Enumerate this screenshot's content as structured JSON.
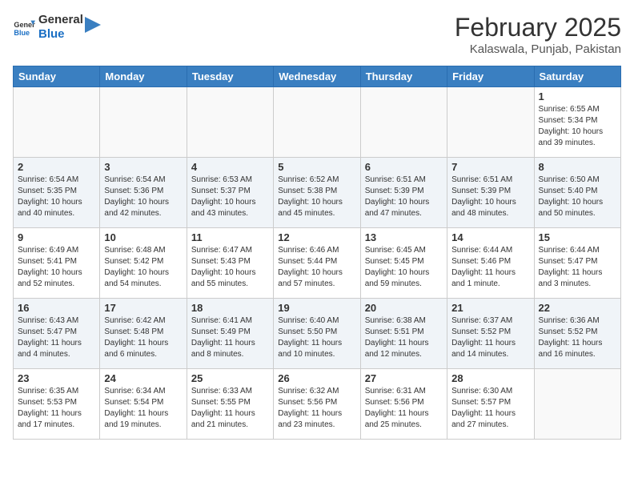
{
  "header": {
    "logo_line1": "General",
    "logo_line2": "Blue",
    "month": "February 2025",
    "location": "Kalaswala, Punjab, Pakistan"
  },
  "days_of_week": [
    "Sunday",
    "Monday",
    "Tuesday",
    "Wednesday",
    "Thursday",
    "Friday",
    "Saturday"
  ],
  "weeks": [
    [
      {
        "day": "",
        "info": ""
      },
      {
        "day": "",
        "info": ""
      },
      {
        "day": "",
        "info": ""
      },
      {
        "day": "",
        "info": ""
      },
      {
        "day": "",
        "info": ""
      },
      {
        "day": "",
        "info": ""
      },
      {
        "day": "1",
        "info": "Sunrise: 6:55 AM\nSunset: 5:34 PM\nDaylight: 10 hours\nand 39 minutes."
      }
    ],
    [
      {
        "day": "2",
        "info": "Sunrise: 6:54 AM\nSunset: 5:35 PM\nDaylight: 10 hours\nand 40 minutes."
      },
      {
        "day": "3",
        "info": "Sunrise: 6:54 AM\nSunset: 5:36 PM\nDaylight: 10 hours\nand 42 minutes."
      },
      {
        "day": "4",
        "info": "Sunrise: 6:53 AM\nSunset: 5:37 PM\nDaylight: 10 hours\nand 43 minutes."
      },
      {
        "day": "5",
        "info": "Sunrise: 6:52 AM\nSunset: 5:38 PM\nDaylight: 10 hours\nand 45 minutes."
      },
      {
        "day": "6",
        "info": "Sunrise: 6:51 AM\nSunset: 5:39 PM\nDaylight: 10 hours\nand 47 minutes."
      },
      {
        "day": "7",
        "info": "Sunrise: 6:51 AM\nSunset: 5:39 PM\nDaylight: 10 hours\nand 48 minutes."
      },
      {
        "day": "8",
        "info": "Sunrise: 6:50 AM\nSunset: 5:40 PM\nDaylight: 10 hours\nand 50 minutes."
      }
    ],
    [
      {
        "day": "9",
        "info": "Sunrise: 6:49 AM\nSunset: 5:41 PM\nDaylight: 10 hours\nand 52 minutes."
      },
      {
        "day": "10",
        "info": "Sunrise: 6:48 AM\nSunset: 5:42 PM\nDaylight: 10 hours\nand 54 minutes."
      },
      {
        "day": "11",
        "info": "Sunrise: 6:47 AM\nSunset: 5:43 PM\nDaylight: 10 hours\nand 55 minutes."
      },
      {
        "day": "12",
        "info": "Sunrise: 6:46 AM\nSunset: 5:44 PM\nDaylight: 10 hours\nand 57 minutes."
      },
      {
        "day": "13",
        "info": "Sunrise: 6:45 AM\nSunset: 5:45 PM\nDaylight: 10 hours\nand 59 minutes."
      },
      {
        "day": "14",
        "info": "Sunrise: 6:44 AM\nSunset: 5:46 PM\nDaylight: 11 hours\nand 1 minute."
      },
      {
        "day": "15",
        "info": "Sunrise: 6:44 AM\nSunset: 5:47 PM\nDaylight: 11 hours\nand 3 minutes."
      }
    ],
    [
      {
        "day": "16",
        "info": "Sunrise: 6:43 AM\nSunset: 5:47 PM\nDaylight: 11 hours\nand 4 minutes."
      },
      {
        "day": "17",
        "info": "Sunrise: 6:42 AM\nSunset: 5:48 PM\nDaylight: 11 hours\nand 6 minutes."
      },
      {
        "day": "18",
        "info": "Sunrise: 6:41 AM\nSunset: 5:49 PM\nDaylight: 11 hours\nand 8 minutes."
      },
      {
        "day": "19",
        "info": "Sunrise: 6:40 AM\nSunset: 5:50 PM\nDaylight: 11 hours\nand 10 minutes."
      },
      {
        "day": "20",
        "info": "Sunrise: 6:38 AM\nSunset: 5:51 PM\nDaylight: 11 hours\nand 12 minutes."
      },
      {
        "day": "21",
        "info": "Sunrise: 6:37 AM\nSunset: 5:52 PM\nDaylight: 11 hours\nand 14 minutes."
      },
      {
        "day": "22",
        "info": "Sunrise: 6:36 AM\nSunset: 5:52 PM\nDaylight: 11 hours\nand 16 minutes."
      }
    ],
    [
      {
        "day": "23",
        "info": "Sunrise: 6:35 AM\nSunset: 5:53 PM\nDaylight: 11 hours\nand 17 minutes."
      },
      {
        "day": "24",
        "info": "Sunrise: 6:34 AM\nSunset: 5:54 PM\nDaylight: 11 hours\nand 19 minutes."
      },
      {
        "day": "25",
        "info": "Sunrise: 6:33 AM\nSunset: 5:55 PM\nDaylight: 11 hours\nand 21 minutes."
      },
      {
        "day": "26",
        "info": "Sunrise: 6:32 AM\nSunset: 5:56 PM\nDaylight: 11 hours\nand 23 minutes."
      },
      {
        "day": "27",
        "info": "Sunrise: 6:31 AM\nSunset: 5:56 PM\nDaylight: 11 hours\nand 25 minutes."
      },
      {
        "day": "28",
        "info": "Sunrise: 6:30 AM\nSunset: 5:57 PM\nDaylight: 11 hours\nand 27 minutes."
      },
      {
        "day": "",
        "info": ""
      }
    ]
  ]
}
